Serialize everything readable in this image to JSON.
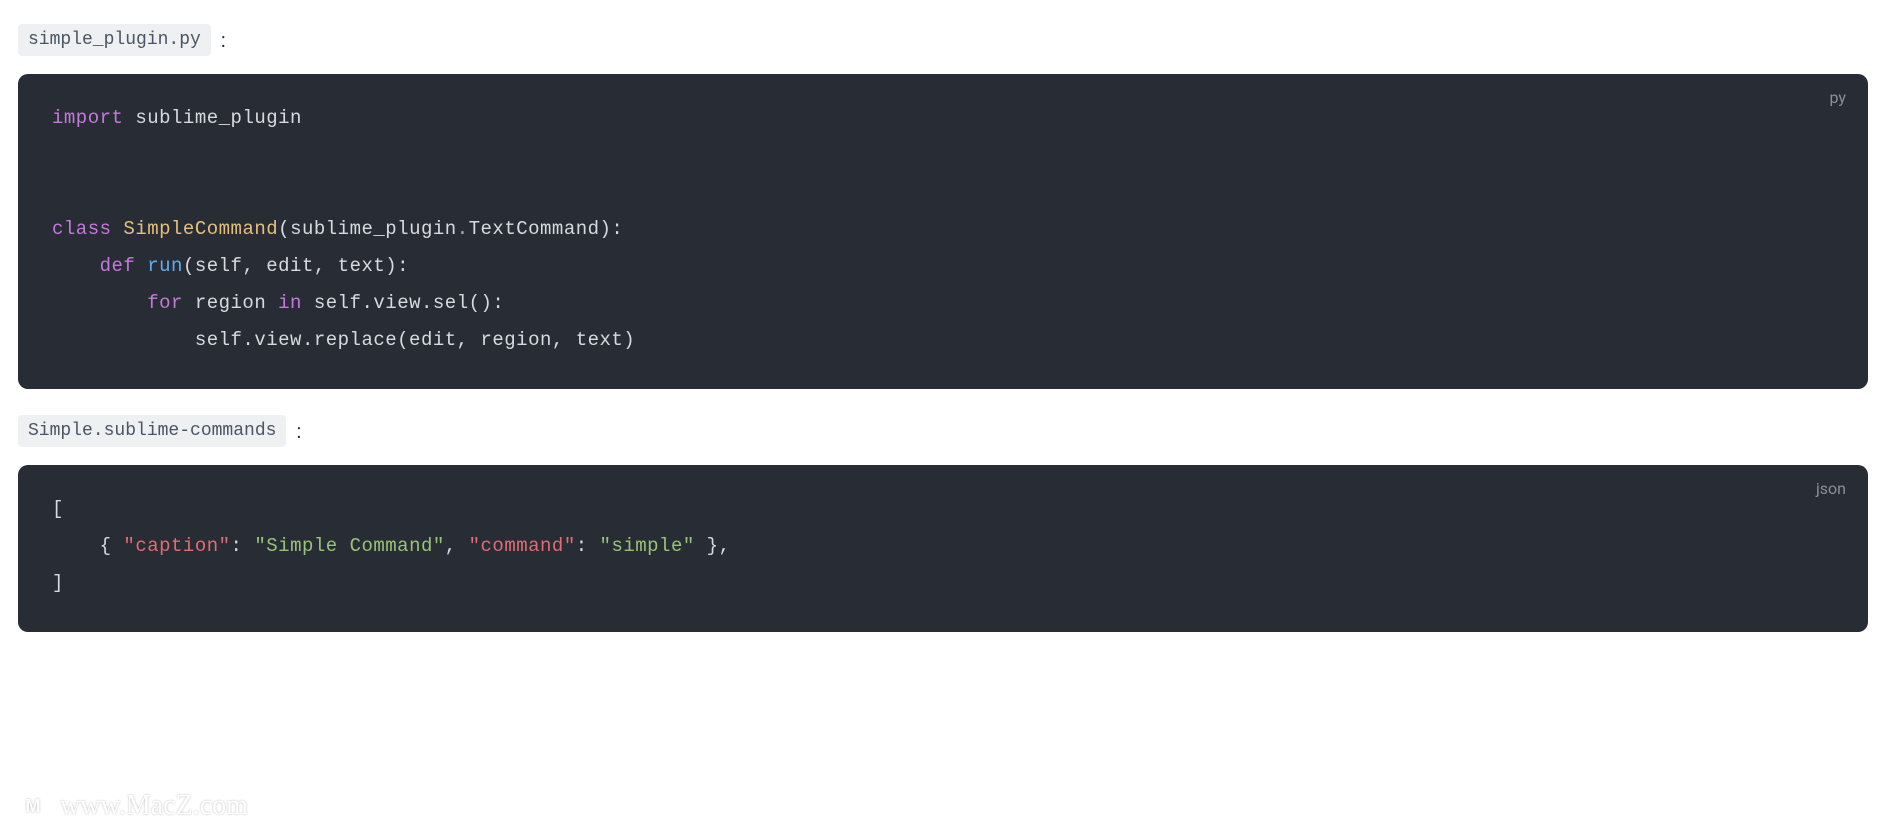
{
  "file1": {
    "name": "simple_plugin.py",
    "lang_badge": "py",
    "code_tokens": [
      [
        {
          "t": "import ",
          "c": "tok-keyword"
        },
        {
          "t": "sublime_plugin",
          "c": ""
        }
      ],
      [],
      [],
      [
        {
          "t": "class ",
          "c": "tok-keyword"
        },
        {
          "t": "SimpleCommand",
          "c": "tok-class"
        },
        {
          "t": "(",
          "c": "tok-paren"
        },
        {
          "t": "sublime_plugin",
          "c": ""
        },
        {
          "t": ".",
          "c": "tok-punct"
        },
        {
          "t": "TextCommand",
          "c": ""
        },
        {
          "t": "):",
          "c": "tok-paren"
        }
      ],
      [
        {
          "t": "    ",
          "c": ""
        },
        {
          "t": "def ",
          "c": "tok-def"
        },
        {
          "t": "run",
          "c": "tok-func"
        },
        {
          "t": "(",
          "c": "tok-paren"
        },
        {
          "t": "self, edit, text",
          "c": ""
        },
        {
          "t": "):",
          "c": "tok-paren"
        }
      ],
      [
        {
          "t": "        ",
          "c": ""
        },
        {
          "t": "for ",
          "c": "tok-keyword"
        },
        {
          "t": "region ",
          "c": ""
        },
        {
          "t": "in ",
          "c": "tok-keyword"
        },
        {
          "t": "self.view.sel():",
          "c": ""
        }
      ],
      [
        {
          "t": "            ",
          "c": ""
        },
        {
          "t": "self.view.replace(edit, region, text)",
          "c": ""
        }
      ]
    ]
  },
  "file2": {
    "name": "Simple.sublime-commands",
    "lang_badge": "json",
    "code_tokens": [
      [
        {
          "t": "[",
          "c": ""
        }
      ],
      [
        {
          "t": "    { ",
          "c": ""
        },
        {
          "t": "\"caption\"",
          "c": "tok-key"
        },
        {
          "t": ": ",
          "c": ""
        },
        {
          "t": "\"Simple Command\"",
          "c": "tok-string"
        },
        {
          "t": ", ",
          "c": ""
        },
        {
          "t": "\"command\"",
          "c": "tok-key"
        },
        {
          "t": ": ",
          "c": ""
        },
        {
          "t": "\"simple\"",
          "c": "tok-string"
        },
        {
          "t": " },",
          "c": ""
        }
      ],
      [
        {
          "t": "]",
          "c": ""
        }
      ]
    ]
  },
  "watermark": {
    "icon_letter": "M",
    "text": "www.MacZ.com"
  }
}
